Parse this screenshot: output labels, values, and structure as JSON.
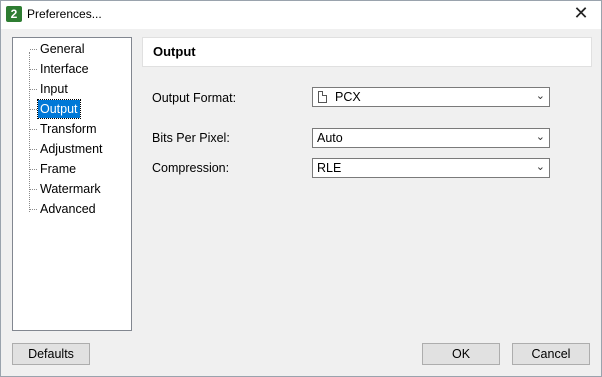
{
  "window": {
    "title": "Preferences...",
    "app_icon_text": "2",
    "close_glyph": "✕"
  },
  "sidebar": {
    "items": [
      {
        "label": "General",
        "selected": false
      },
      {
        "label": "Interface",
        "selected": false
      },
      {
        "label": "Input",
        "selected": false
      },
      {
        "label": "Output",
        "selected": true
      },
      {
        "label": "Transform",
        "selected": false
      },
      {
        "label": "Adjustment",
        "selected": false
      },
      {
        "label": "Frame",
        "selected": false
      },
      {
        "label": "Watermark",
        "selected": false
      },
      {
        "label": "Advanced",
        "selected": false
      }
    ]
  },
  "panel": {
    "title": "Output",
    "fields": [
      {
        "label": "Output Format:",
        "value": "PCX",
        "icon": "file-icon"
      },
      {
        "label": "Bits Per Pixel:",
        "value": "Auto"
      },
      {
        "label": "Compression:",
        "value": "RLE"
      }
    ]
  },
  "buttons": {
    "defaults": "Defaults",
    "ok": "OK",
    "cancel": "Cancel"
  },
  "colors": {
    "selection": "#0078d7",
    "background": "#f0f0f0"
  }
}
